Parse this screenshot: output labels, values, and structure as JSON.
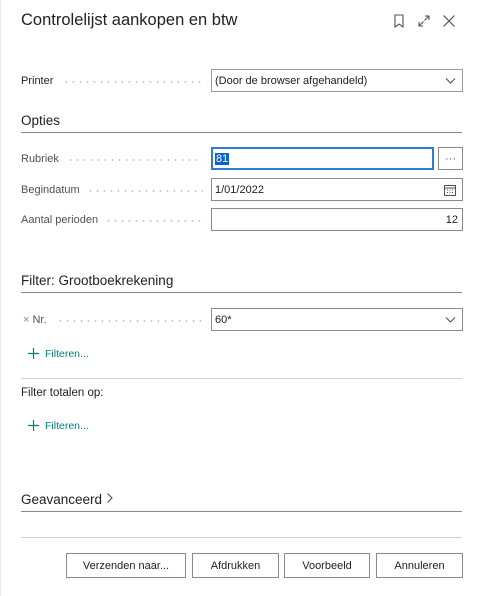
{
  "dialog": {
    "title": "Controlelijst aankopen en btw",
    "icons": [
      "bookmark-icon",
      "expand-icon",
      "close-icon"
    ]
  },
  "printer": {
    "label": "Printer",
    "value": "(Door de browser afgehandeld)"
  },
  "options": {
    "heading": "Opties",
    "rubriek_label": "Rubriek",
    "rubriek_value": "81",
    "lookup_label": "···",
    "begindatum_label": "Begindatum",
    "begindatum_value": "1/01/2022",
    "aantal_label": "Aantal perioden",
    "aantal_value": "12"
  },
  "filter": {
    "heading": "Filter: Grootboekrekening",
    "remove_glyph": "×",
    "nr_label": "Nr.",
    "nr_value": "60*",
    "add_filter_label": "Filteren...",
    "totals_label": "Filter totalen op:",
    "add_totals_filter_label": "Filteren..."
  },
  "advanced": {
    "heading": "Geavanceerd"
  },
  "footer": {
    "send_label": "Verzenden naar...",
    "print_label": "Afdrukken",
    "preview_label": "Voorbeeld",
    "cancel_label": "Annuleren"
  },
  "colors": {
    "accent": "#00807a",
    "focus": "#0d62c9"
  }
}
